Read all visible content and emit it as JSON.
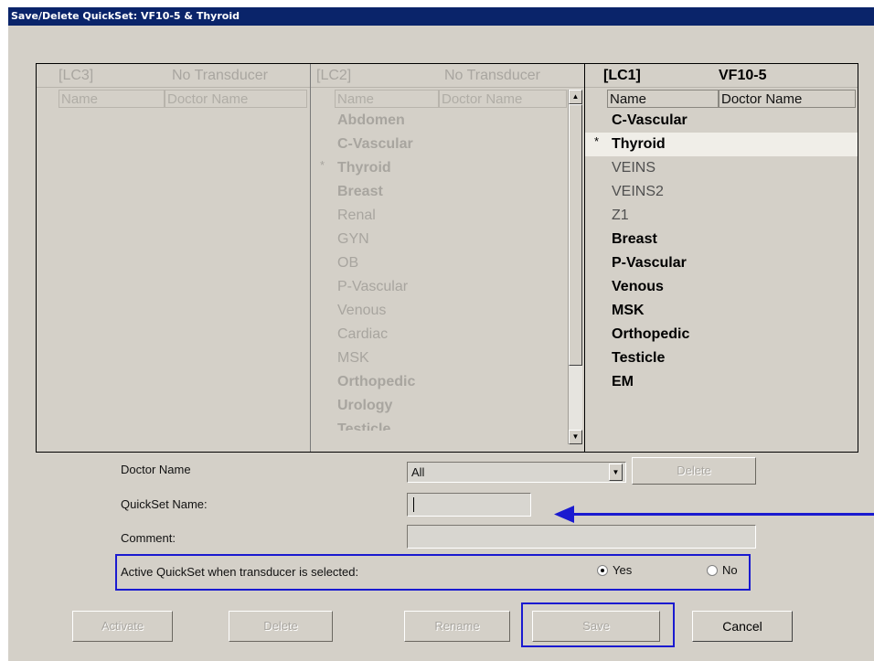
{
  "window": {
    "title": "Save/Delete QuickSet: VF10-5 & Thyroid"
  },
  "columns": [
    {
      "slot": "[LC3]",
      "transducer": "No Transducer",
      "name_header": "Name",
      "doctor_header": "Doctor Name",
      "items": []
    },
    {
      "slot": "[LC2]",
      "transducer": "No Transducer",
      "name_header": "Name",
      "doctor_header": "Doctor Name",
      "items": [
        {
          "label": "Abdomen",
          "mark": ""
        },
        {
          "label": "C-Vascular",
          "mark": ""
        },
        {
          "label": "Thyroid",
          "mark": "*"
        },
        {
          "label": "Breast",
          "mark": ""
        },
        {
          "label": "Renal",
          "mark": ""
        },
        {
          "label": "GYN",
          "mark": ""
        },
        {
          "label": "OB",
          "mark": ""
        },
        {
          "label": "P-Vascular",
          "mark": ""
        },
        {
          "label": "Venous",
          "mark": ""
        },
        {
          "label": "Cardiac",
          "mark": ""
        },
        {
          "label": "MSK",
          "mark": ""
        },
        {
          "label": "Orthopedic",
          "mark": ""
        },
        {
          "label": "Urology",
          "mark": ""
        },
        {
          "label": "Testicle",
          "mark": ""
        }
      ]
    },
    {
      "slot": "[LC1]",
      "transducer": "VF10-5",
      "name_header": "Name",
      "doctor_header": "Doctor Name",
      "items": [
        {
          "label": "C-Vascular",
          "mark": ""
        },
        {
          "label": "Thyroid",
          "mark": "*"
        },
        {
          "label": "VEINS",
          "mark": ""
        },
        {
          "label": "VEINS2",
          "mark": ""
        },
        {
          "label": "Z1",
          "mark": ""
        },
        {
          "label": "Breast",
          "mark": ""
        },
        {
          "label": "P-Vascular",
          "mark": ""
        },
        {
          "label": "Venous",
          "mark": ""
        },
        {
          "label": "MSK",
          "mark": ""
        },
        {
          "label": "Orthopedic",
          "mark": ""
        },
        {
          "label": "Testicle",
          "mark": ""
        },
        {
          "label": "EM",
          "mark": ""
        }
      ]
    }
  ],
  "form": {
    "doctor_name_label": "Doctor Name",
    "doctor_name_value": "All",
    "delete_label": "Delete",
    "quickset_name_label": "QuickSet Name:",
    "quickset_name_value": "",
    "comment_label": "Comment:",
    "comment_value": "",
    "active_label": "Active QuickSet when transducer is selected:",
    "yes_label": "Yes",
    "no_label": "No",
    "active_selected": "Yes"
  },
  "buttons": {
    "activate": "Activate",
    "delete": "Delete",
    "rename": "Rename",
    "save": "Save",
    "cancel": "Cancel"
  },
  "icons": {
    "scroll_up": "scroll-up-arrow-icon",
    "scroll_down": "scroll-down-arrow-icon",
    "combo_dropdown": "chevron-down-icon",
    "annotation_arrow": "arrow-left-icon"
  },
  "colors": {
    "title_bar": "#0a246a",
    "annotation": "#1a1ad0",
    "window_bg": "#d4d0c8"
  }
}
